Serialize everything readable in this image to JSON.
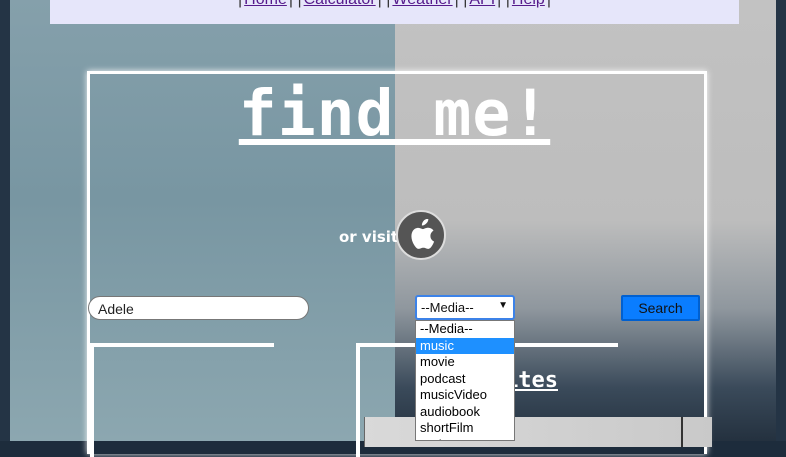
{
  "nav": {
    "links": [
      "Home",
      "Calculator",
      "Weather",
      "API",
      "Help"
    ]
  },
  "hero": {
    "title": "find me!",
    "or_visit": "or visit",
    "apple_icon": "apple-icon"
  },
  "search": {
    "value": "Adele",
    "select_value": "--Media--",
    "button_label": "Search",
    "options": [
      "--Media--",
      "music",
      "movie",
      "podcast",
      "musicVideo",
      "audiobook",
      "shortFilm",
      "tvShow"
    ],
    "selected_index": 1
  },
  "favorites": {
    "label": "ites"
  },
  "colors": {
    "accent": "#0a7dff",
    "nav_bg": "#e6e6fa",
    "selected": "#1e90ff"
  }
}
